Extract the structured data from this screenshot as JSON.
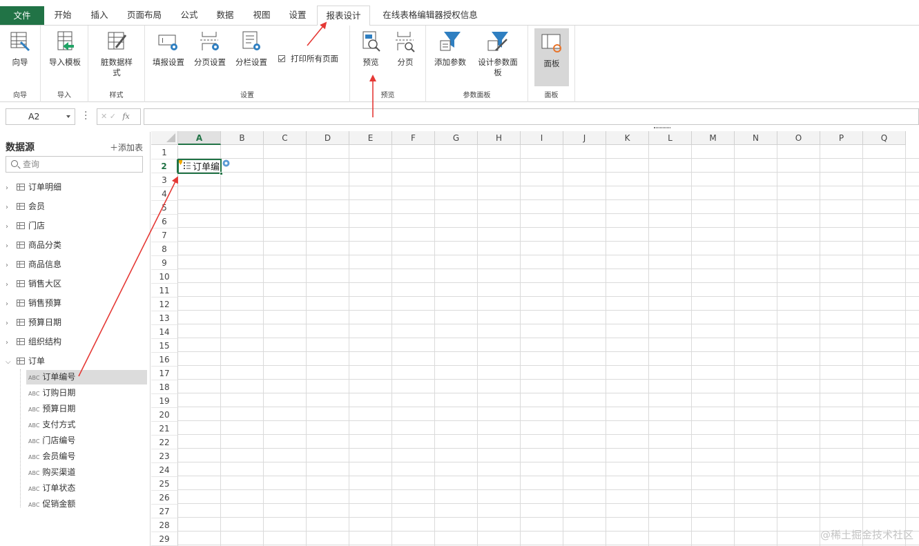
{
  "tabs": {
    "file": "文件",
    "home": "开始",
    "insert": "插入",
    "page_layout": "页面布局",
    "formula": "公式",
    "data": "数据",
    "view": "视图",
    "settings": "设置",
    "report_design": "报表设计",
    "license": "在线表格编辑器授权信息"
  },
  "ribbon": {
    "wizard": "向导",
    "wizard_group": "向导",
    "import_template": "导入模板",
    "import_group": "导入",
    "dirty_style": "脏数据样式",
    "style_group": "样式",
    "fill_settings": "填报设置",
    "paging_settings": "分页设置",
    "column_settings": "分栏设置",
    "print_all_pages": "打印所有页面",
    "settings_group": "设置",
    "preview": "预览",
    "paging": "分页",
    "preview_group": "预览",
    "add_param": "添加参数",
    "design_param_panel": "设计参数面板",
    "param_panel_group": "参数面板",
    "panel": "面板",
    "panel_group": "面板"
  },
  "formula_bar": {
    "name_box": "A2",
    "fx": "fx",
    "value": ""
  },
  "datasource": {
    "title": "数据源",
    "add_table": "添加表",
    "search_placeholder": "查询",
    "tables": [
      "订单明细",
      "会员",
      "门店",
      "商品分类",
      "商品信息",
      "销售大区",
      "销售预算",
      "预算日期",
      "组织结构",
      "订单"
    ],
    "expanded_table": "订单",
    "field_type_label": "ABC",
    "fields": [
      "订单编号",
      "订购日期",
      "预算日期",
      "支付方式",
      "门店编号",
      "会员编号",
      "购买渠道",
      "订单状态",
      "促销金额"
    ],
    "selected_field": "订单编号"
  },
  "sheet": {
    "columns": [
      "A",
      "B",
      "C",
      "D",
      "E",
      "F",
      "G",
      "H",
      "I",
      "J",
      "K",
      "L",
      "M",
      "N",
      "O",
      "P",
      "Q"
    ],
    "rows": [
      "1",
      "2",
      "3",
      "4",
      "5",
      "6",
      "7",
      "8",
      "9",
      "10",
      "11",
      "12",
      "13",
      "14",
      "15",
      "16",
      "17",
      "18",
      "19",
      "20",
      "21",
      "22",
      "23",
      "24",
      "25",
      "26",
      "27",
      "28",
      "29"
    ],
    "active_cell": "A2",
    "active_cell_value": "订单编"
  },
  "watermark": "@稀土掘金技术社区",
  "colors": {
    "accent_green": "#217346",
    "arrow_red": "#e53935",
    "icon_blue": "#2f7fc1"
  }
}
